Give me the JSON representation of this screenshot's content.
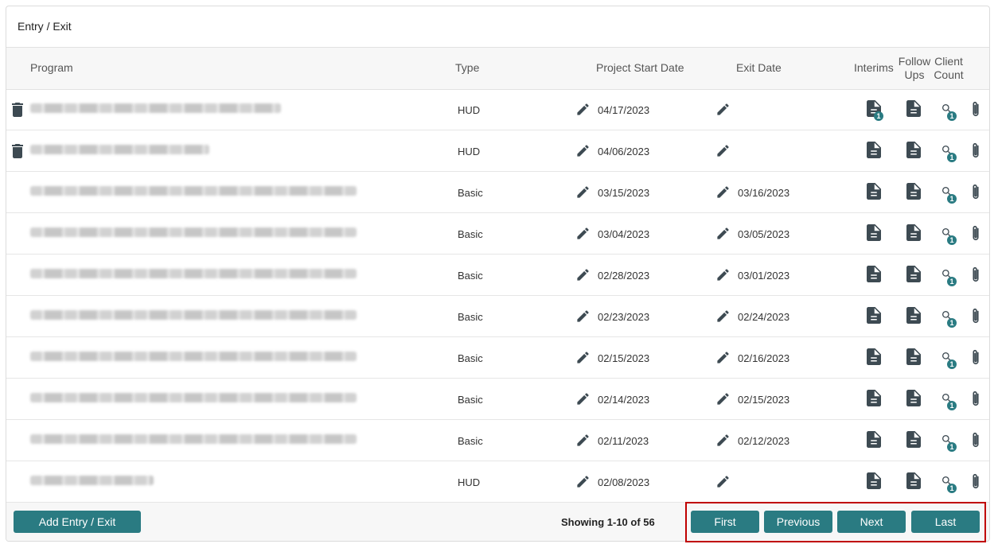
{
  "page": {
    "title": "Entry / Exit"
  },
  "columns": {
    "program": "Program",
    "type": "Type",
    "start_date": "Project Start Date",
    "exit_date": "Exit Date",
    "interims": "Interims",
    "follow_ups_line1": "Follow",
    "follow_ups_line2": "Ups",
    "client_count_line1": "Client",
    "client_count_line2": "Count"
  },
  "rows": [
    {
      "type": "HUD",
      "start_date": "04/17/2023",
      "exit_date": "",
      "interim_badge": "1",
      "client_badge": "1",
      "deletable": true
    },
    {
      "type": "HUD",
      "start_date": "04/06/2023",
      "exit_date": "",
      "interim_badge": "",
      "client_badge": "1",
      "deletable": true
    },
    {
      "type": "Basic",
      "start_date": "03/15/2023",
      "exit_date": "03/16/2023",
      "interim_badge": "",
      "client_badge": "1",
      "deletable": false
    },
    {
      "type": "Basic",
      "start_date": "03/04/2023",
      "exit_date": "03/05/2023",
      "interim_badge": "",
      "client_badge": "1",
      "deletable": false
    },
    {
      "type": "Basic",
      "start_date": "02/28/2023",
      "exit_date": "03/01/2023",
      "interim_badge": "",
      "client_badge": "1",
      "deletable": false
    },
    {
      "type": "Basic",
      "start_date": "02/23/2023",
      "exit_date": "02/24/2023",
      "interim_badge": "",
      "client_badge": "1",
      "deletable": false
    },
    {
      "type": "Basic",
      "start_date": "02/15/2023",
      "exit_date": "02/16/2023",
      "interim_badge": "",
      "client_badge": "1",
      "deletable": false
    },
    {
      "type": "Basic",
      "start_date": "02/14/2023",
      "exit_date": "02/15/2023",
      "interim_badge": "",
      "client_badge": "1",
      "deletable": false
    },
    {
      "type": "Basic",
      "start_date": "02/11/2023",
      "exit_date": "02/12/2023",
      "interim_badge": "",
      "client_badge": "1",
      "deletable": false
    },
    {
      "type": "HUD",
      "start_date": "02/08/2023",
      "exit_date": "",
      "interim_badge": "",
      "client_badge": "1",
      "deletable": false
    }
  ],
  "footer": {
    "add_label": "Add Entry / Exit",
    "showing": "Showing 1-10 of 56",
    "first": "First",
    "previous": "Previous",
    "next": "Next",
    "last": "Last"
  },
  "colors": {
    "accent": "#2a7b82",
    "icon": "#3d4a52",
    "highlight": "#c00000"
  }
}
